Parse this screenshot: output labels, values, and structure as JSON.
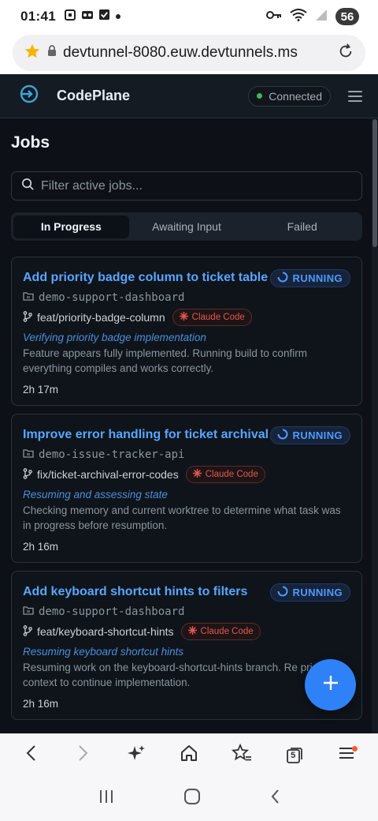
{
  "status_bar": {
    "time": "01:41",
    "battery": "56"
  },
  "browser": {
    "url": "devtunnel-8080.euw.devtunnels.ms",
    "tab_count": "5"
  },
  "app": {
    "name": "CodePlane",
    "connection_status": "Connected"
  },
  "page": {
    "title": "Jobs",
    "search_placeholder": "Filter active jobs..."
  },
  "tabs": [
    {
      "label": "In Progress",
      "active": true
    },
    {
      "label": "Awaiting Input",
      "active": false
    },
    {
      "label": "Failed",
      "active": false
    }
  ],
  "jobs": [
    {
      "title": "Add priority badge column to ticket table",
      "status": "RUNNING",
      "repo": "demo-support-dashboard",
      "branch": "feat/priority-badge-column",
      "agent": "Claude Code",
      "status_title": "Verifying priority badge implementation",
      "description": "Feature appears fully implemented. Running build to confirm everything compiles and works correctly.",
      "elapsed": "2h 17m"
    },
    {
      "title": "Improve error handling for ticket archival",
      "status": "RUNNING",
      "repo": "demo-issue-tracker-api",
      "branch": "fix/ticket-archival-error-codes",
      "agent": "Claude Code",
      "status_title": "Resuming and assessing state",
      "description": "Checking memory and current worktree to determine what task was in progress before resumption.",
      "elapsed": "2h 16m"
    },
    {
      "title": "Add keyboard shortcut hints to filters",
      "status": "RUNNING",
      "repo": "demo-support-dashboard",
      "branch": "feat/keyboard-shortcut-hints",
      "agent": "Claude Code",
      "status_title": "Resuming keyboard shortcut hints",
      "description": "Resuming work on the keyboard-shortcut-hints branch. Re prior context to continue implementation.",
      "elapsed": "2h 16m"
    }
  ],
  "colors": {
    "accent": "#2f81f7",
    "link": "#58a6ff",
    "connected": "#3fb950",
    "agent": "#e4574e",
    "background": "#0d1117"
  }
}
